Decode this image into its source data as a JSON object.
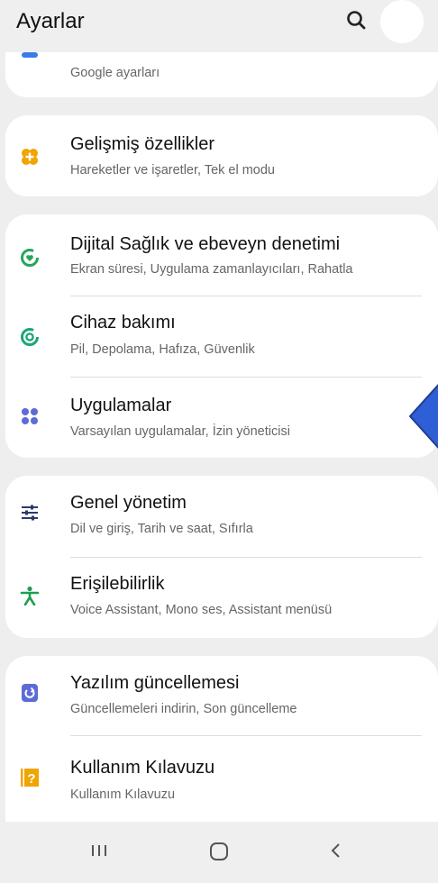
{
  "header": {
    "title": "Ayarlar"
  },
  "items": [
    {
      "key": "google",
      "label": "",
      "sub": "Google ayarları",
      "icon": "google-icon"
    },
    {
      "key": "advanced",
      "label": "Gelişmiş özellikler",
      "sub": "Hareketler ve işaretler, Tek el modu",
      "icon": "advanced-features-icon"
    },
    {
      "key": "wellbeing",
      "label": "Dijital Sağlık ve ebeveyn denetimi",
      "sub": "Ekran süresi, Uygulama zamanlayıcıları, Rahatla",
      "icon": "digital-wellbeing-icon"
    },
    {
      "key": "care",
      "label": "Cihaz bakımı",
      "sub": "Pil, Depolama, Hafıza, Güvenlik",
      "icon": "device-care-icon"
    },
    {
      "key": "apps",
      "label": "Uygulamalar",
      "sub": "Varsayılan uygulamalar, İzin yöneticisi",
      "icon": "apps-icon"
    },
    {
      "key": "general",
      "label": "Genel yönetim",
      "sub": "Dil ve giriş, Tarih ve saat, Sıfırla",
      "icon": "general-management-icon"
    },
    {
      "key": "access",
      "label": "Erişilebilirlik",
      "sub": "Voice Assistant, Mono ses, Assistant menüsü",
      "icon": "accessibility-icon"
    },
    {
      "key": "update",
      "label": "Yazılım güncellemesi",
      "sub": "Güncellemeleri indirin, Son güncelleme",
      "icon": "software-update-icon"
    },
    {
      "key": "manual",
      "label": "Kullanım Kılavuzu",
      "sub": "Kullanım Kılavuzu",
      "icon": "user-manual-icon"
    }
  ],
  "navbar": {
    "recents": "recents-icon",
    "home": "home-icon",
    "back": "back-icon"
  },
  "colors": {
    "background": "#eeeeee",
    "card": "#ffffff",
    "blue_icon": "#3b7be8",
    "orange_icon": "#f0a500",
    "green_icon": "#26a65b",
    "teal_icon": "#1aa67a",
    "purple_icon": "#5c6bd6",
    "pointer_arrow": "#2f5fd6"
  }
}
